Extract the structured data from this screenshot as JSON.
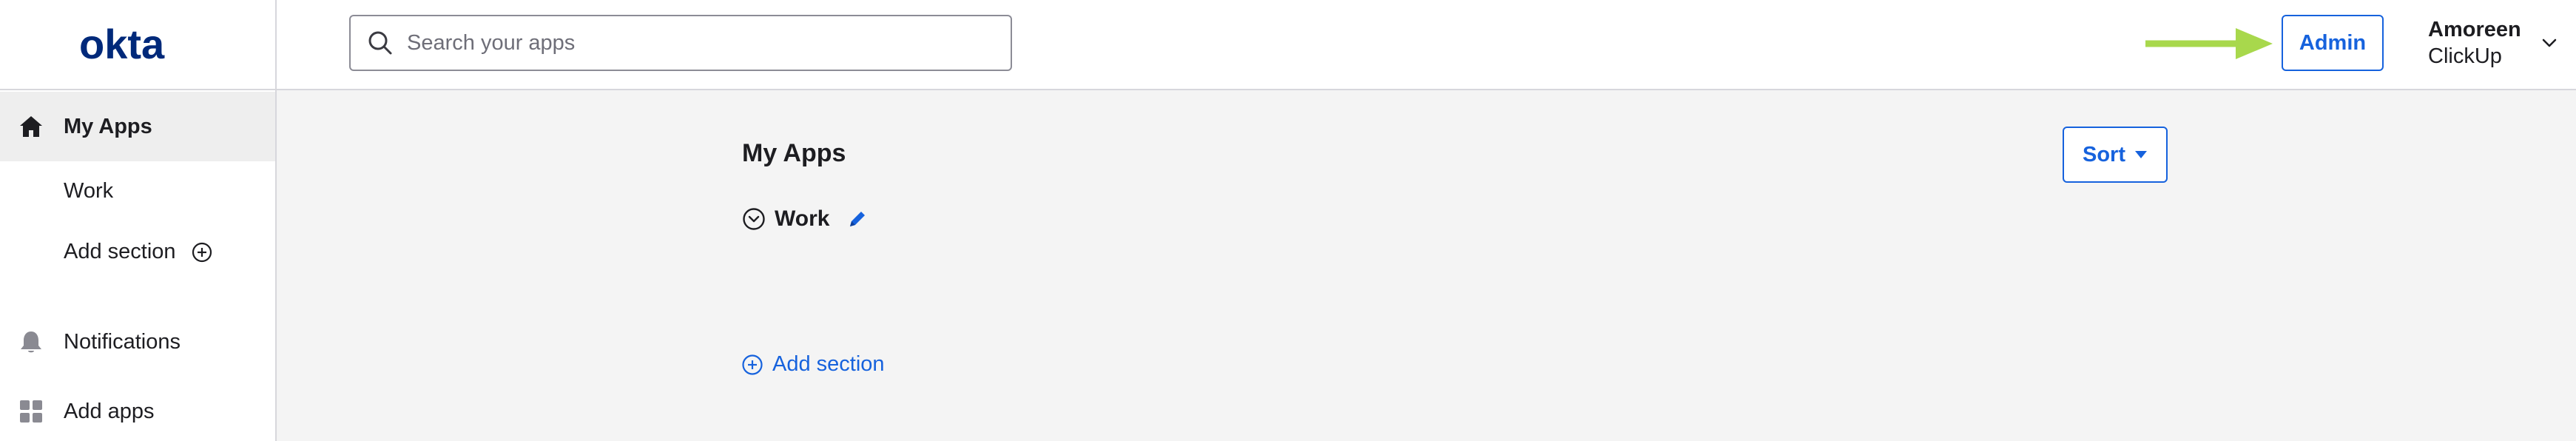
{
  "brand": {
    "logo_text": "okta",
    "logo_color": "#00297a"
  },
  "header": {
    "search_placeholder": "Search your apps",
    "admin_label": "Admin",
    "user": {
      "name": "Amoreen",
      "org": "ClickUp"
    },
    "annotation_arrow_color": "#a8d84c"
  },
  "sidebar": {
    "items": [
      {
        "label": "My Apps",
        "icon": "home-icon",
        "active": true
      },
      {
        "label": "Work"
      },
      {
        "label": "Add section",
        "icon": "plus-circle-icon"
      },
      {
        "label": "Notifications",
        "icon": "bell-icon"
      },
      {
        "label": "Add apps",
        "icon": "grid-icon"
      }
    ]
  },
  "main": {
    "title": "My Apps",
    "sort_label": "Sort",
    "section": {
      "label": "Work"
    },
    "add_section_label": "Add section"
  },
  "colors": {
    "accent": "#1662dd",
    "background": "#f4f4f4",
    "border": "#d7d7dc"
  }
}
